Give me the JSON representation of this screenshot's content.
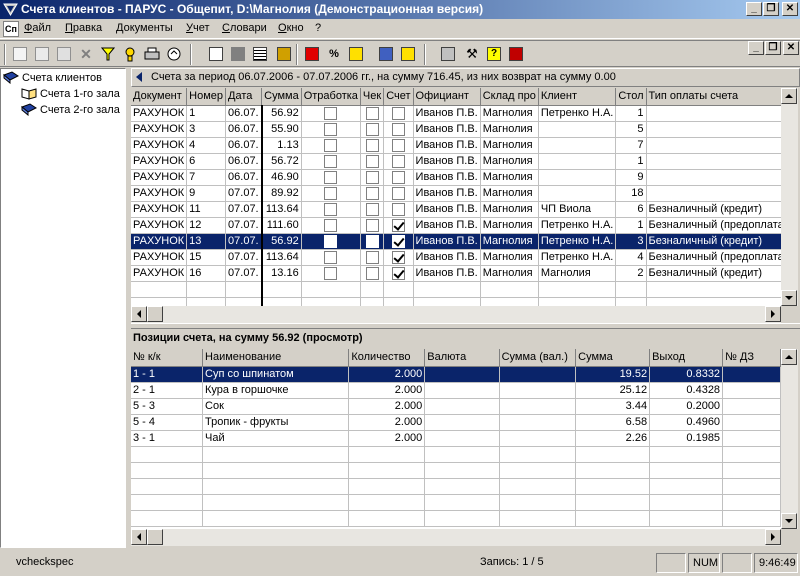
{
  "window": {
    "title": "Счета клиентов - ПАРУС - Общепит, D:\\Магнолия (Демонстрационная версия)",
    "caption_buttons": [
      "_",
      "❐",
      "✕"
    ]
  },
  "menu": {
    "icon_label": "Сп",
    "items": [
      "Файл",
      "Правка",
      "Документы",
      "Учет",
      "Словари",
      "Окно",
      "?"
    ]
  },
  "toolbar": {
    "icons": [
      "add-icon",
      "copy-icon",
      "edit-icon",
      "delete-icon",
      "filter-icon",
      "search-icon",
      "print-icon",
      "refresh-icon",
      "calc-icon",
      "tools-icon",
      "help-icon",
      "exit-icon"
    ]
  },
  "tree": {
    "root": "Счета клиентов",
    "children": [
      "Счета 1-го зала",
      "Счета 2-го зала"
    ]
  },
  "invoices": {
    "info": "Счета  за период 06.07.2006 - 07.07.2006 гг., на сумму 716.45, из них возврат на сумму 0.00",
    "columns": [
      "Документ",
      "Номер",
      "Дата",
      "Сумма",
      "Отработка",
      "Чек",
      "Счет",
      "Официант",
      "Склад про",
      "Клиент",
      "Стол",
      "Тип оплаты счета"
    ],
    "rows": [
      {
        "doc": "РАХУНОК",
        "num": "1",
        "date": "06.07.",
        "sum": "56.92",
        "otr": false,
        "chek": false,
        "schet": false,
        "waiter": "Иванов П.В.",
        "store": "Магнолия",
        "client": "Петренко Н.А.",
        "table": "1",
        "pay": ""
      },
      {
        "doc": "РАХУНОК",
        "num": "3",
        "date": "06.07.",
        "sum": "55.90",
        "otr": false,
        "chek": false,
        "schet": false,
        "waiter": "Иванов П.В.",
        "store": "Магнолия",
        "client": "",
        "table": "5",
        "pay": ""
      },
      {
        "doc": "РАХУНОК",
        "num": "4",
        "date": "06.07.",
        "sum": "1.13",
        "otr": false,
        "chek": false,
        "schet": false,
        "waiter": "Иванов П.В.",
        "store": "Магнолия",
        "client": "",
        "table": "7",
        "pay": ""
      },
      {
        "doc": "РАХУНОК",
        "num": "6",
        "date": "06.07.",
        "sum": "56.72",
        "otr": false,
        "chek": false,
        "schet": false,
        "waiter": "Иванов П.В.",
        "store": "Магнолия",
        "client": "",
        "table": "1",
        "pay": ""
      },
      {
        "doc": "РАХУНОК",
        "num": "7",
        "date": "06.07.",
        "sum": "46.90",
        "otr": false,
        "chek": false,
        "schet": false,
        "waiter": "Иванов П.В.",
        "store": "Магнолия",
        "client": "",
        "table": "9",
        "pay": ""
      },
      {
        "doc": "РАХУНОК",
        "num": "9",
        "date": "07.07.",
        "sum": "89.92",
        "otr": false,
        "chek": false,
        "schet": false,
        "waiter": "Иванов П.В.",
        "store": "Магнолия",
        "client": "",
        "table": "18",
        "pay": ""
      },
      {
        "doc": "РАХУНОК",
        "num": "11",
        "date": "07.07.",
        "sum": "113.64",
        "otr": false,
        "chek": false,
        "schet": false,
        "waiter": "Иванов П.В.",
        "store": "Магнолия",
        "client": "ЧП Виола",
        "table": "6",
        "pay": "Безналичный (кредит)"
      },
      {
        "doc": "РАХУНОК",
        "num": "12",
        "date": "07.07.",
        "sum": "111.60",
        "otr": false,
        "chek": false,
        "schet": true,
        "waiter": "Иванов П.В.",
        "store": "Магнолия",
        "client": "Петренко Н.А.",
        "table": "1",
        "pay": "Безналичный (предоплата)"
      },
      {
        "doc": "РАХУНОК",
        "num": "13",
        "date": "07.07.",
        "sum": "56.92",
        "otr": false,
        "chek": false,
        "schet": true,
        "waiter": "Иванов П.В.",
        "store": "Магнолия",
        "client": "Петренко Н.А.",
        "table": "3",
        "pay": "Безналичный (кредит)",
        "selected": true
      },
      {
        "doc": "РАХУНОК",
        "num": "15",
        "date": "07.07.",
        "sum": "113.64",
        "otr": false,
        "chek": false,
        "schet": true,
        "waiter": "Иванов П.В.",
        "store": "Магнолия",
        "client": "Петренко Н.А.",
        "table": "4",
        "pay": "Безналичный (предоплата)"
      },
      {
        "doc": "РАХУНОК",
        "num": "16",
        "date": "07.07.",
        "sum": "13.16",
        "otr": false,
        "chek": false,
        "schet": true,
        "waiter": "Иванов П.В.",
        "store": "Магнолия",
        "client": "Магнолия",
        "table": "2",
        "pay": "Безналичный (кредит)"
      }
    ]
  },
  "positions": {
    "title": "Позиции счета, на сумму 56.92 (просмотр)",
    "columns": [
      "№ к/к",
      "Наименование",
      "Количество",
      "Валюта",
      "Сумма (вал.)",
      "Сумма",
      "Выход",
      "№ ДЗ"
    ],
    "rows": [
      {
        "kk": "1 - 1",
        "name": "Суп со шпинатом",
        "qty": "2.000",
        "cur": "",
        "sumcur": "",
        "sum": "19.52",
        "out": "0.8332",
        "dz": "",
        "selected": true
      },
      {
        "kk": "2 - 1",
        "name": "Кура в горшочке",
        "qty": "2.000",
        "cur": "",
        "sumcur": "",
        "sum": "25.12",
        "out": "0.4328",
        "dz": ""
      },
      {
        "kk": "5 - 3",
        "name": "Сок",
        "qty": "2.000",
        "cur": "",
        "sumcur": "",
        "sum": "3.44",
        "out": "0.2000",
        "dz": ""
      },
      {
        "kk": "5 - 4",
        "name": "Тропик - фрукты",
        "qty": "2.000",
        "cur": "",
        "sumcur": "",
        "sum": "6.58",
        "out": "0.4960",
        "dz": ""
      },
      {
        "kk": "3 - 1",
        "name": "Чай",
        "qty": "2.000",
        "cur": "",
        "sumcur": "",
        "sum": "2.26",
        "out": "0.1985",
        "dz": ""
      }
    ]
  },
  "status": {
    "form": "vcheckspec",
    "record": "Запись: 1 / 5",
    "num": "NUM",
    "time": "9:46:49"
  },
  "colors": {
    "title_start": "#0a246a",
    "title_end": "#a6caf0",
    "selection": "#0a246a",
    "face": "#d4d0c8"
  }
}
